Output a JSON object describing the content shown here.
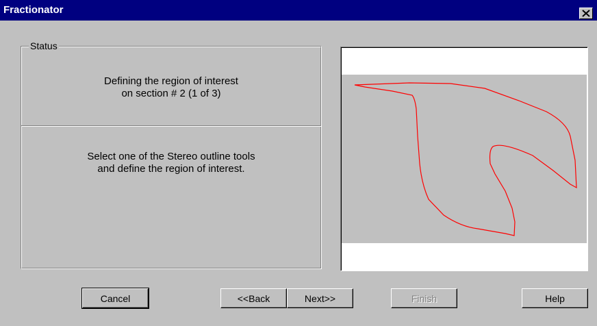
{
  "window": {
    "title": "Fractionator",
    "close_icon": "close-icon"
  },
  "status": {
    "group_label": "Status",
    "line1": "Defining the region of interest",
    "line2": "on section # 2 (1 of 3)",
    "line3": "Select one of the Stereo outline tools",
    "line4": "and define the region of interest."
  },
  "preview": {
    "outline_color": "#ff0000",
    "band_color": "#c0c0c0",
    "border_color": "#ffffff"
  },
  "buttons": {
    "cancel": "Cancel",
    "back": "<<Back",
    "next": "Next>>",
    "finish": "Finish",
    "help": "Help"
  }
}
